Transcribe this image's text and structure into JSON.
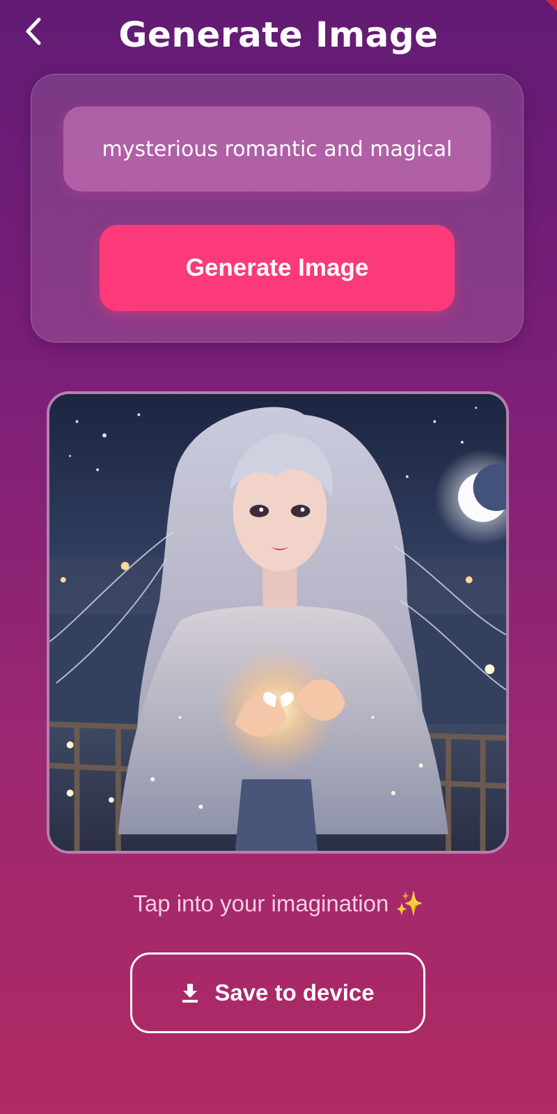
{
  "header": {
    "title": "Generate Image",
    "back_icon": "chevron-left-icon"
  },
  "prompt": {
    "value": "mysterious romantic and magical",
    "generate_label": "Generate Image"
  },
  "image": {
    "subject": "long-haired girl holding glowing butterfly under crescent moon at night"
  },
  "tagline": "Tap into your imagination ✨",
  "save": {
    "label": "Save to device",
    "icon": "download-icon"
  },
  "colors": {
    "background_top": "#621b74",
    "background_bottom": "#b02a63",
    "accent": "#fc3a79"
  }
}
